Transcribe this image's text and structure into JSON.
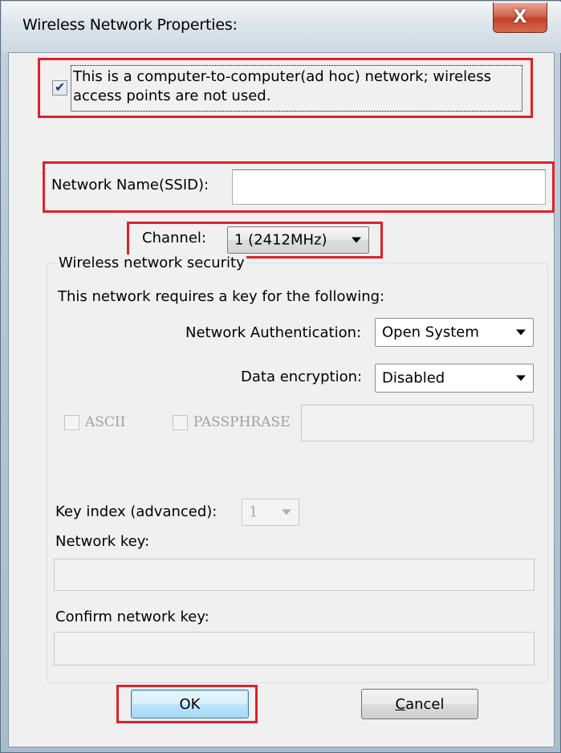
{
  "window": {
    "title": "Wireless Network Properties:",
    "close_glyph": "X"
  },
  "adhoc": {
    "checked": true,
    "label_line1": "This is a computer-to-computer(ad hoc) network; wireless",
    "label_line2": "access points are not used."
  },
  "ssid": {
    "label": "Network Name(SSID):",
    "value": ""
  },
  "channel": {
    "label": "Channel:",
    "selected": "1  (2412MHz)"
  },
  "security": {
    "group_title": "Wireless network security",
    "requires_text": "This network requires a key for the following:",
    "auth_label": "Network Authentication:",
    "auth_selected": "Open System",
    "encryption_label": "Data encryption:",
    "encryption_selected": "Disabled",
    "ascii_label": "ASCII",
    "passphrase_label": "PASSPHRASE",
    "passphrase_value": "",
    "key_index_label": "Key index (advanced):",
    "key_index_selected": "1",
    "network_key_label": "Network key:",
    "network_key_value": "",
    "confirm_key_label": "Confirm network key:",
    "confirm_key_value": ""
  },
  "buttons": {
    "ok": "OK",
    "cancel_pre": "",
    "cancel_mnemonic": "C",
    "cancel_post": "ancel"
  },
  "colors": {
    "highlight": "#e0202a",
    "close_button": "#c2432a",
    "default_button": "#a7d9f5"
  },
  "icons": {
    "check": "check-mark-icon",
    "dropdown": "chevron-down-icon",
    "close": "close-icon"
  }
}
